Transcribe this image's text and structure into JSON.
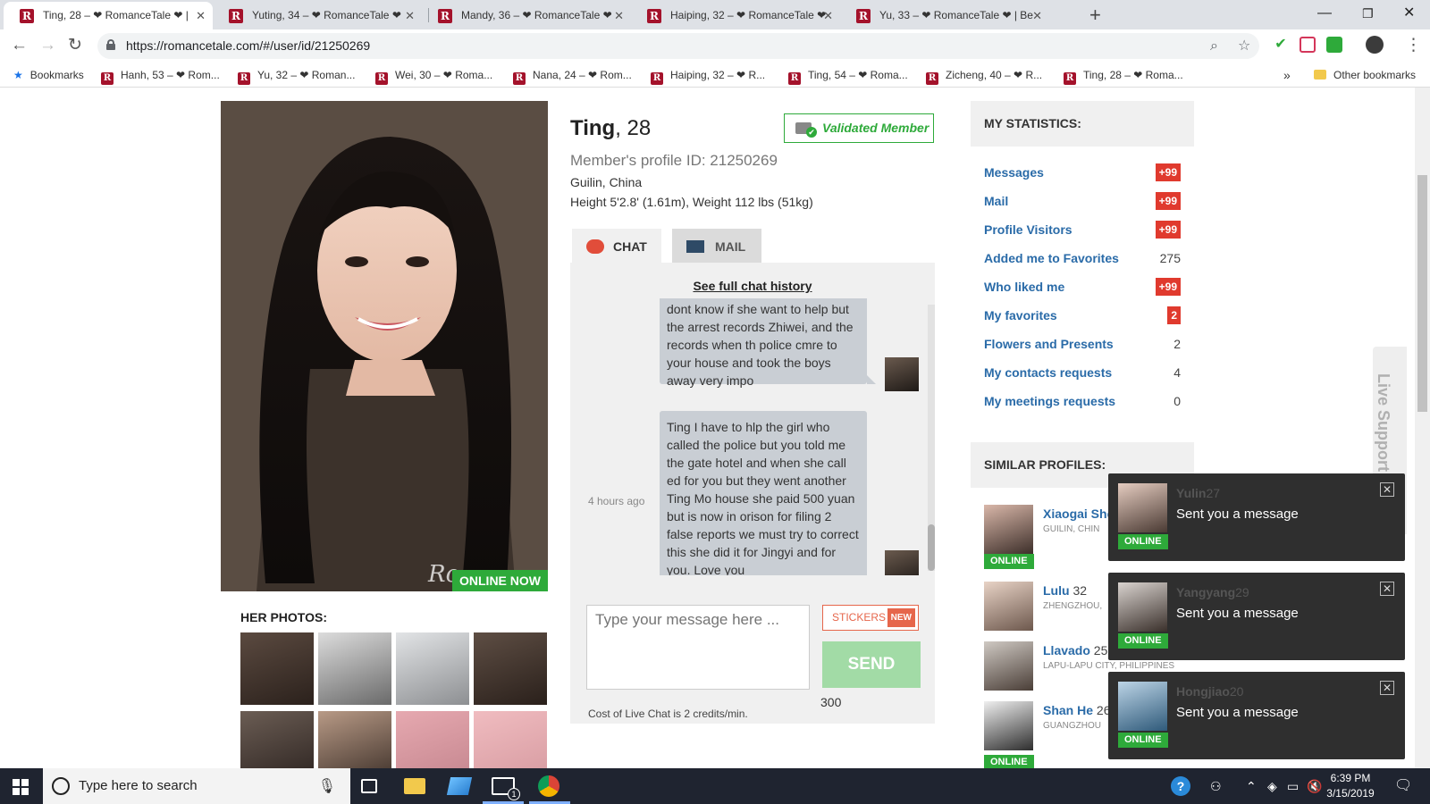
{
  "browser": {
    "tabs": [
      {
        "title": "Ting, 28 – ❤ RomanceTale ❤ |",
        "active": true
      },
      {
        "title": "Yuting, 34 – ❤ RomanceTale ❤",
        "active": false
      },
      {
        "title": "Mandy, 36 – ❤ RomanceTale ❤",
        "active": false
      },
      {
        "title": "Haiping, 32 – ❤ RomanceTale ❤",
        "active": false
      },
      {
        "title": "Yu, 33 – ❤ RomanceTale ❤ | Be",
        "active": false
      }
    ],
    "favicon_letter": "R",
    "url": "https://romancetale.com/#/user/id/21250269",
    "bookmarks_label": "Bookmarks",
    "bookmarks": [
      "Hanh, 53 – ❤ Rom...",
      "Yu, 32 – ❤ Roman...",
      "Wei, 30 – ❤ Roma...",
      "Nana, 24 – ❤ Rom...",
      "Haiping, 32 – ❤ R...",
      "Ting, 54 – ❤ Roma...",
      "Zicheng, 40 – ❤ R...",
      "Ting, 28 – ❤ Roma..."
    ],
    "more_bookmarks": "»",
    "other_bookmarks": "Other bookmarks"
  },
  "profile": {
    "name": "Ting",
    "age": ", 28",
    "validated": "Validated Member",
    "profile_id": "Member's profile ID: 21250269",
    "location": "Guilin, China",
    "height_weight": "Height 5'2.8' (1.61m), Weight 112 lbs (51kg)",
    "online_now": "ONLINE NOW",
    "watermark": "Ro",
    "her_photos": "HER PHOTOS:"
  },
  "chat": {
    "tab_chat": "CHAT",
    "tab_mail": "MAIL",
    "full_history": "See full chat history",
    "messages": [
      {
        "text": "dont know if she want to help but the arrest records Zhiwei, and the records when th police cmre to your house and took the boys away very impo"
      },
      {
        "text": "Ting I have to hlp the girl who called the police but you told me the gate hotel and when she call ed for you but they went another Ting Mo house she paid 500 yuan but is now in orison for filing 2 false reports we must try to correct this she did it for Jingyi and for you. Love you",
        "time": "4 hours ago"
      }
    ],
    "placeholder": "Type your message here ...",
    "stickers": "STICKERS",
    "new_badge": "NEW",
    "send": "SEND",
    "char_count": "300",
    "cost": "Cost of Live Chat is 2 credits/min."
  },
  "stats": {
    "title": "MY STATISTICS:",
    "rows": [
      {
        "label": "Messages",
        "value": "+99",
        "badge": true
      },
      {
        "label": "Mail",
        "value": "+99",
        "badge": true
      },
      {
        "label": "Profile Visitors",
        "value": "+99",
        "badge": true
      },
      {
        "label": "Added me to Favorites",
        "value": "275",
        "badge": false
      },
      {
        "label": "Who liked me",
        "value": "+99",
        "badge": true
      },
      {
        "label": "My favorites",
        "value": "2",
        "badge": true
      },
      {
        "label": "Flowers and Presents",
        "value": "2",
        "badge": false
      },
      {
        "label": "My contacts requests",
        "value": "4",
        "badge": false
      },
      {
        "label": "My meetings requests",
        "value": "0",
        "badge": false
      }
    ]
  },
  "similar": {
    "title": "SIMILAR PROFILES:",
    "online_label": "ONLINE",
    "items": [
      {
        "name": "Xiaogai She",
        "age": "",
        "location": "GUILIN, CHIN",
        "online": true
      },
      {
        "name": "Lulu",
        "age": "32",
        "location": "ZHENGZHOU,",
        "online": false
      },
      {
        "name": "Llavado",
        "age": "25",
        "location": "LAPU-LAPU CITY, PHILIPPINES",
        "online": false
      },
      {
        "name": "Shan He",
        "age": "26",
        "location": "GUANGZHOU",
        "online": true
      }
    ]
  },
  "live_support": "Live Support",
  "notifications": [
    {
      "name": "Yulin",
      "age": "27",
      "message": "Sent you a message",
      "online": "ONLINE"
    },
    {
      "name": "Yangyang",
      "age": "29",
      "message": "Sent you a message",
      "online": "ONLINE"
    },
    {
      "name": "Hongjiao",
      "age": "20",
      "message": "Sent you a message",
      "online": "ONLINE"
    }
  ],
  "taskbar": {
    "search_placeholder": "Type here to search",
    "mail_badge": "1",
    "time": "6:39 PM",
    "date": "3/15/2019"
  }
}
